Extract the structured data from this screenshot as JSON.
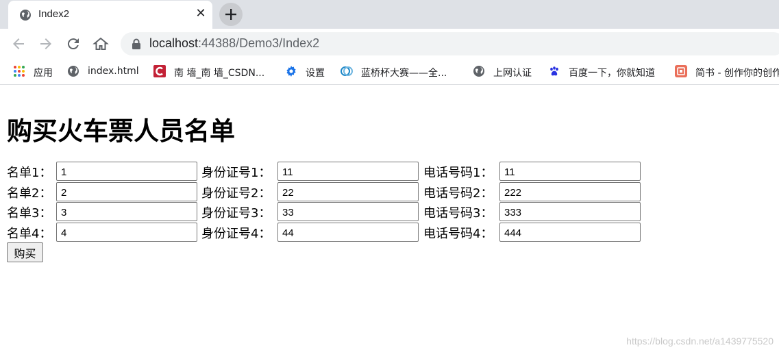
{
  "browser": {
    "tab_title": "Index2",
    "close_symbol": "✕",
    "url_host": "localhost",
    "url_path": ":44388/Demo3/Index2",
    "bookmarks": [
      {
        "label": "应用",
        "icon": "apps-grid-icon"
      },
      {
        "label": "index.html",
        "icon": "globe-icon"
      },
      {
        "label": "南 墙_南 墙_CSDN...",
        "icon": "csdn-icon"
      },
      {
        "label": "设置",
        "icon": "gear-icon"
      },
      {
        "label": "蓝桥杯大赛——全...",
        "icon": "lanqiao-icon"
      },
      {
        "label": "上网认证",
        "icon": "globe-icon"
      },
      {
        "label": "百度一下，你就知道",
        "icon": "baidu-paw-icon"
      },
      {
        "label": "简书 - 创作你的创作",
        "icon": "jianshu-icon"
      }
    ]
  },
  "page": {
    "heading": "购买火车票人员名单",
    "rows": [
      {
        "name_label": "名单1：",
        "name_value": "1",
        "id_label": "身份证号1：",
        "id_value": "11",
        "phone_label": "电话号码1：",
        "phone_value": "11"
      },
      {
        "name_label": "名单2：",
        "name_value": "2",
        "id_label": "身份证号2：",
        "id_value": "22",
        "phone_label": "电话号码2：",
        "phone_value": "222"
      },
      {
        "name_label": "名单3：",
        "name_value": "3",
        "id_label": "身份证号3：",
        "id_value": "33",
        "phone_label": "电话号码3：",
        "phone_value": "333"
      },
      {
        "name_label": "名单4：",
        "name_value": "4",
        "id_label": "身份证号4：",
        "id_value": "44",
        "phone_label": "电话号码4：",
        "phone_value": "444"
      }
    ],
    "submit_label": "购买",
    "watermark": "https://blog.csdn.net/a1439775520"
  },
  "colors": {
    "tabstrip": "#dee1e6",
    "omnibox": "#f1f3f4",
    "csdn_red": "#c32136",
    "settings_blue": "#1a73e8",
    "baidu_blue": "#2932e1",
    "jianshu_red": "#ea6f5a"
  }
}
